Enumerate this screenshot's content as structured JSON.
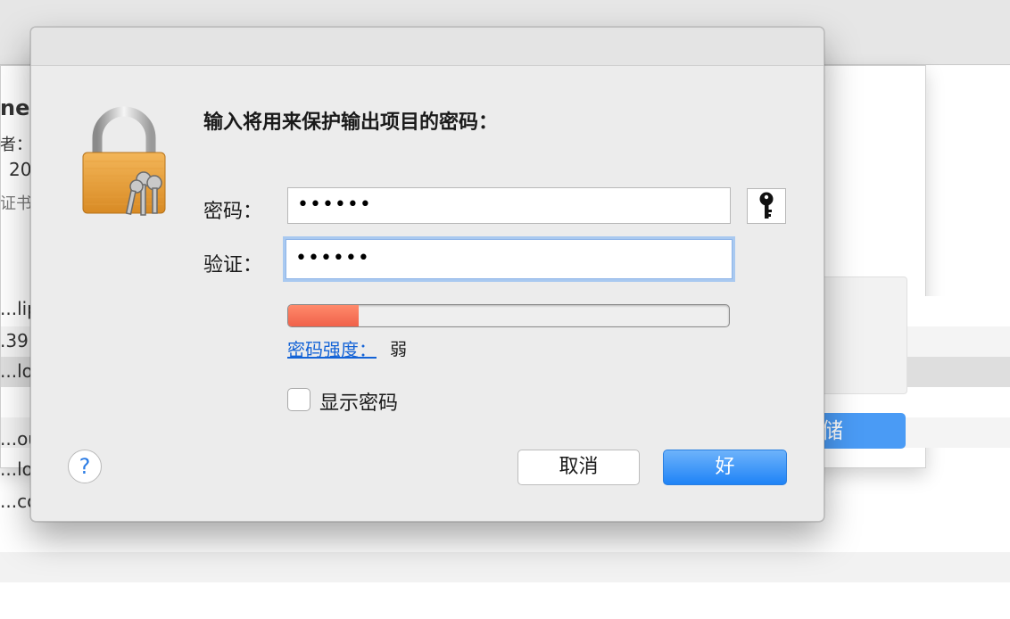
{
  "background": {
    "side_texts": [
      "ne",
      "者：",
      "20",
      "证书",
      "...lip",
      ".39",
      "...lo",
      "...ou",
      "...lor",
      "...co"
    ],
    "save_label": "存储"
  },
  "dialog": {
    "prompt": "输入将用来保护输出项目的密码：",
    "password_label": "密码：",
    "password_value": "••••••",
    "verify_label": "验证：",
    "verify_value": "••••••",
    "strength_link": "密码强度：",
    "strength_value": "弱",
    "strength_level": 0.16,
    "show_password_label": "显示密码",
    "help_label": "?",
    "cancel_label": "取消",
    "ok_label": "好"
  },
  "colors": {
    "accent": "#1f83f6",
    "strength_weak": "#f0614a",
    "focus_ring": "#a9c9f0"
  }
}
